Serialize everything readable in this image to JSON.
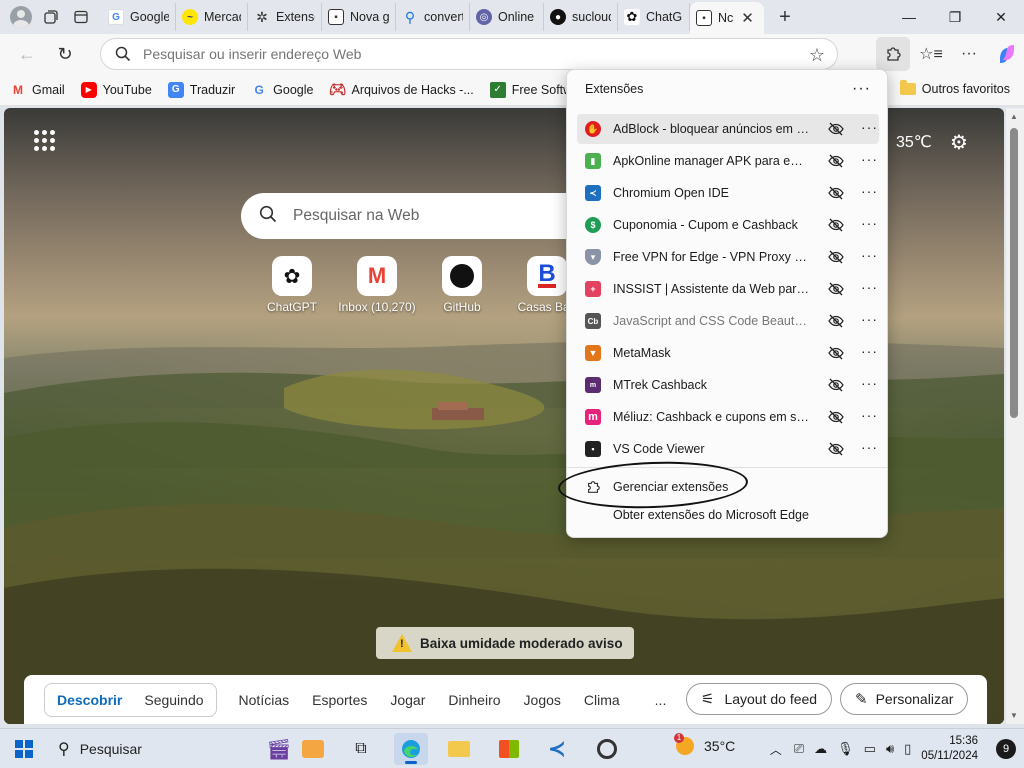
{
  "browser": {
    "tabs": [
      {
        "label": "Google",
        "color": "#4285f4"
      },
      {
        "label": "Mercad",
        "color": "#ffe600"
      },
      {
        "label": "Extensõ",
        "color": "#555555"
      },
      {
        "label": "Nova g",
        "color": "#333333"
      },
      {
        "label": "convert",
        "color": "#1a73e8"
      },
      {
        "label": "Online C",
        "color": "#6264a7"
      },
      {
        "label": "sucloud",
        "color": "#111111"
      },
      {
        "label": "ChatGP",
        "color": "#111111"
      },
      {
        "label": "Nc",
        "color": "#444444"
      }
    ],
    "address_placeholder": "Pesquisar ou inserir endereço Web"
  },
  "favorites": {
    "items": [
      {
        "label": "Gmail"
      },
      {
        "label": "YouTube"
      },
      {
        "label": "Traduzir"
      },
      {
        "label": "Google"
      },
      {
        "label": "Arquivos de Hacks -..."
      },
      {
        "label": "Free Software"
      }
    ],
    "other": "Outros favoritos"
  },
  "newtab": {
    "weather_temp": "35℃",
    "search_placeholder": "Pesquisar na Web",
    "quick_links": [
      {
        "label": "ChatGPT"
      },
      {
        "label": "Inbox (10,270)"
      },
      {
        "label": "GitHub"
      },
      {
        "label": "Casas Bah"
      }
    ],
    "alert": "Baixa umidade moderado aviso",
    "feed_tabs": [
      "Descobrir",
      "Seguindo"
    ],
    "feed_links": [
      "Notícias",
      "Esportes",
      "Jogar",
      "Dinheiro",
      "Jogos",
      "Clima"
    ],
    "more": "...",
    "layout_button": "Layout do feed",
    "personalize_button": "Personalizar"
  },
  "extensions_popup": {
    "title": "Extensões",
    "items": [
      {
        "name": "AdBlock - bloquear anúncios em t...",
        "icon_color": "#e01e1e"
      },
      {
        "name": "ApkOnline manager APK para emu...",
        "icon_color": "#4caf50"
      },
      {
        "name": "Chromium Open IDE",
        "icon_color": "#1e6fbf"
      },
      {
        "name": "Cuponomia - Cupom e Cashback",
        "icon_color": "#1f9d55"
      },
      {
        "name": "Free VPN for Edge - VPN Proxy Ve...",
        "icon_color": "#8a94a6"
      },
      {
        "name": "INSSIST | Assistente da Web para I...",
        "icon_color": "#e4405f"
      },
      {
        "name": "JavaScript and CSS Code Beautifier",
        "icon_color": "#555555"
      },
      {
        "name": "MetaMask",
        "icon_color": "#e2761b"
      },
      {
        "name": "MTrek Cashback",
        "icon_color": "#5b2c6f"
      },
      {
        "name": "Méliuz: Cashback e cupons em sua...",
        "icon_color": "#e5237a"
      },
      {
        "name": "VS Code Viewer",
        "icon_color": "#222222"
      }
    ],
    "manage": "Gerenciar extensões",
    "get_more": "Obter extensões do Microsoft Edge"
  },
  "taskbar": {
    "search": "Pesquisar",
    "weather": "35°C",
    "time": "15:36",
    "date": "05/11/2024",
    "notifications": "9"
  }
}
